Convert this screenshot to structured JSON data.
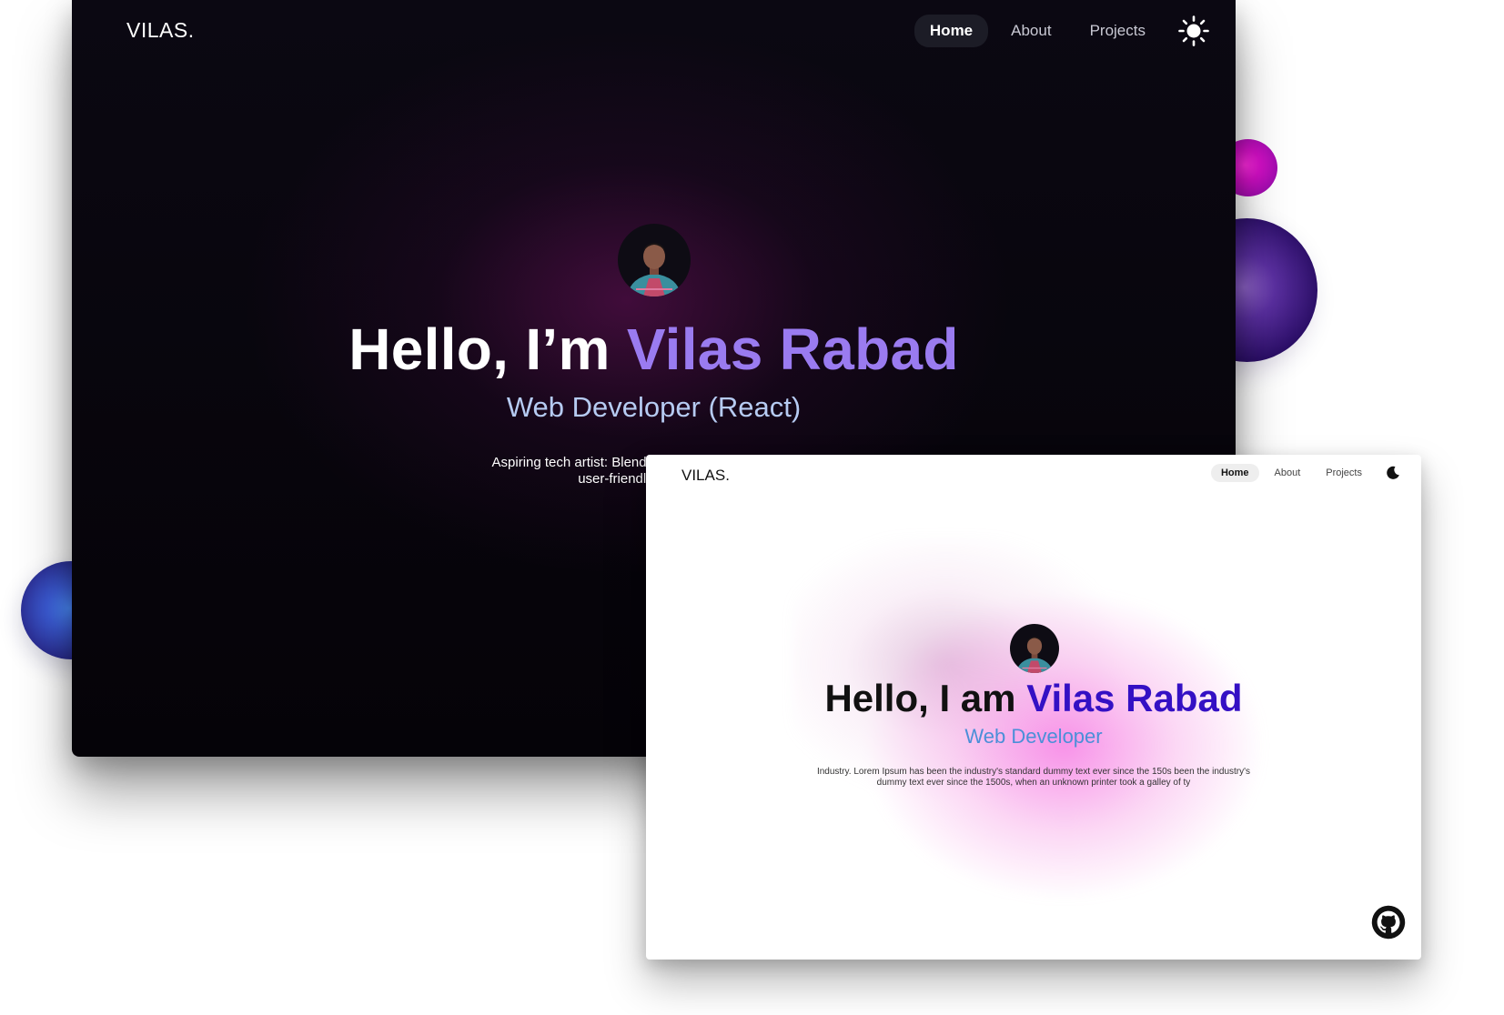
{
  "dark_site": {
    "logo": "VILAS.",
    "nav": [
      {
        "label": "Home",
        "active": true
      },
      {
        "label": "About",
        "active": false
      },
      {
        "label": "Projects",
        "active": false
      }
    ],
    "theme_icon": "sun-icon",
    "greeting": "Hello, I’m",
    "name": "Vilas Rabad",
    "subtitle": "Web Developer (React)",
    "description_line1": "Aspiring tech artist: Blending logic and creativity, I'm a",
    "description_line2": "user-friendly web experie"
  },
  "light_site": {
    "logo": "VILAS.",
    "nav": [
      {
        "label": "Home",
        "active": true
      },
      {
        "label": "About",
        "active": false
      },
      {
        "label": "Projects",
        "active": false
      }
    ],
    "theme_icon": "moon-icon",
    "greeting": "Hello, I am",
    "name": "Vilas Rabad",
    "subtitle": "Web Developer",
    "description_line1": "Industry. Lorem Ipsum has been the industry's standard dummy text ever since the 150s been the industry's",
    "description_line2": "dummy text ever since the 1500s, when an unknown printer took a galley of ty",
    "footer_icon": "github-icon"
  },
  "colors": {
    "dark_accent": "#9a7bf0",
    "dark_subtitle": "#b6cbf2",
    "light_accent": "#3410c4",
    "light_subtitle": "#4b8fd8",
    "glow_pink": "#f56ee1"
  }
}
